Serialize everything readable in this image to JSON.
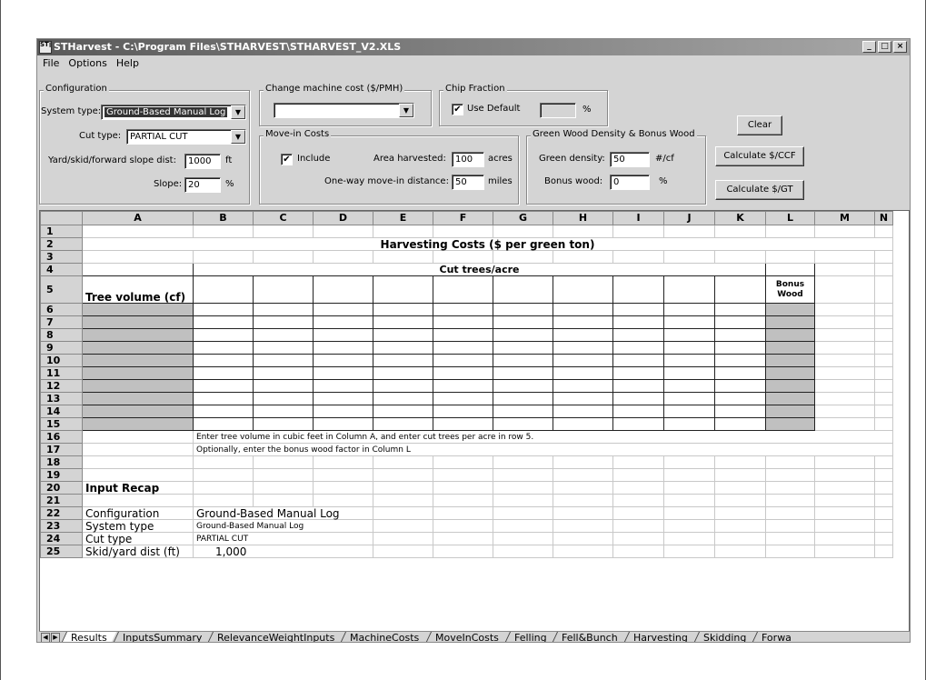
{
  "window": {
    "title": "STHarvest - C:\\Program Files\\STHARVEST\\STHARVEST_V2.XLS",
    "buttons": {
      "minimize": "_",
      "maximize": "□",
      "close": "×"
    }
  },
  "menu": [
    "File",
    "Options",
    "Help"
  ],
  "configuration": {
    "title": "Configuration",
    "system_type_label": "System type:",
    "system_type_value": "Ground-Based Manual Log",
    "cut_type_label": "Cut type:",
    "cut_type_value": "PARTIAL CUT",
    "slope_dist_label": "Yard/skid/forward slope dist:",
    "slope_dist_value": "1000",
    "slope_dist_unit": "ft",
    "slope_label": "Slope:",
    "slope_value": "20",
    "slope_unit": "%"
  },
  "machine_cost": {
    "title": "Change machine cost ($/PMH)",
    "value": ""
  },
  "chip_fraction": {
    "title": "Chip Fraction",
    "use_default_label": "Use Default",
    "use_default_checked": true,
    "value": "",
    "unit": "%"
  },
  "move_in": {
    "title": "Move-in Costs",
    "include_label": "Include",
    "include_checked": true,
    "area_label": "Area harvested:",
    "area_value": "100",
    "area_unit": "acres",
    "distance_label": "One-way move-in distance:",
    "distance_value": "50",
    "distance_unit": "miles"
  },
  "density": {
    "title": "Green Wood Density & Bonus Wood",
    "density_label": "Green density:",
    "density_value": "50",
    "density_unit": "#/cf",
    "bonus_label": "Bonus wood:",
    "bonus_value": "0",
    "bonus_unit": "%"
  },
  "actions": {
    "clear": "Clear",
    "calc_ccf": "Calculate $/CCF",
    "calc_gt": "Calculate $/GT"
  },
  "sheet": {
    "columns": [
      "A",
      "B",
      "C",
      "D",
      "E",
      "F",
      "G",
      "H",
      "I",
      "J",
      "K",
      "L",
      "M",
      "N"
    ],
    "rows": [
      "1",
      "2",
      "3",
      "4",
      "5",
      "6",
      "7",
      "8",
      "9",
      "10",
      "11",
      "12",
      "13",
      "14",
      "15",
      "16",
      "17",
      "18",
      "19",
      "20",
      "21",
      "22",
      "23",
      "24",
      "25"
    ],
    "heading": "Harvesting Costs ($ per green ton)",
    "cut_trees_header": "Cut trees/acre",
    "tree_volume_header": "Tree volume (cf)",
    "bonus_wood_header": "Bonus Wood",
    "note1": "Enter tree volume in cubic feet in Column A, and enter cut trees per acre in row 5.",
    "note2": "Optionally, enter the bonus wood factor in Column L",
    "input_recap": "Input Recap",
    "recap_configuration_label": "Configuration",
    "recap_configuration_value": "Ground-Based Manual Log",
    "recap_system_label": "System type",
    "recap_system_value": "Ground-Based Manual Log",
    "recap_cut_label": "Cut type",
    "recap_cut_value": "PARTIAL CUT",
    "recap_skid_label": "Skid/yard dist (ft)",
    "recap_skid_value": "1,000"
  },
  "tabs": [
    "Results",
    "InputsSummary",
    "RelevanceWeightInputs",
    "MachineCosts",
    "MoveInCosts",
    "Felling",
    "Fell&Bunch",
    "Harvesting",
    "Skidding",
    "Forwa"
  ],
  "active_tab": "Results"
}
